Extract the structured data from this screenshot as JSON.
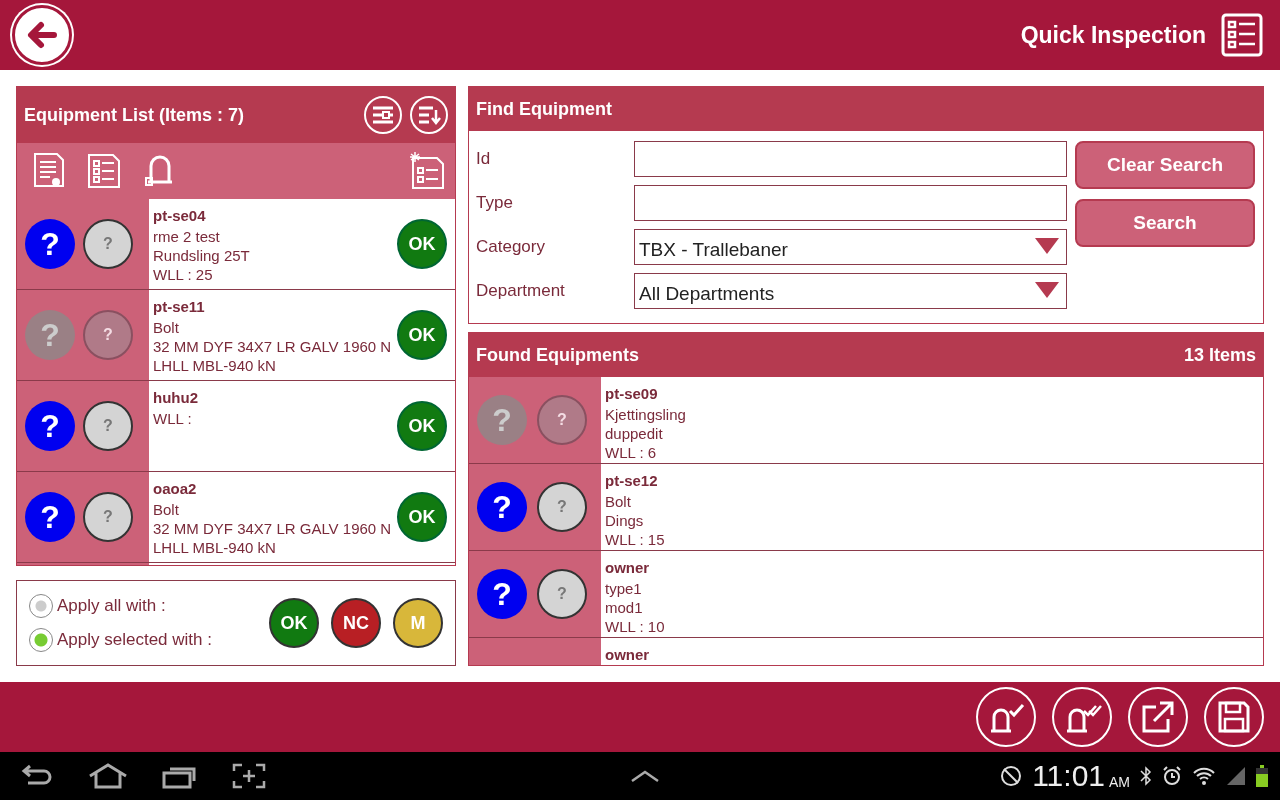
{
  "header": {
    "title": "Quick Inspection"
  },
  "equipment_list": {
    "title": "Equipment List (Items : 7)",
    "rows": [
      {
        "id": "pt-se04",
        "marks": [
          "?",
          "?"
        ],
        "lines": [
          "rme 2 test",
          "Rundsling 25T",
          "WLL : 25"
        ],
        "disabled": false,
        "status": "OK"
      },
      {
        "id": "pt-se11",
        "marks": [
          "?",
          "?"
        ],
        "lines": [
          "Bolt",
          "32 MM DYF 34X7 LR GALV 1960 N",
          "LHLL MBL-940 kN"
        ],
        "disabled": true,
        "status": "OK"
      },
      {
        "id": "huhu2",
        "marks": [
          "?",
          "?"
        ],
        "lines": [
          "WLL :"
        ],
        "disabled": false,
        "status": "OK"
      },
      {
        "id": "oaoa2",
        "marks": [
          "?",
          "?"
        ],
        "lines": [
          "Bolt",
          "32 MM DYF 34X7 LR GALV 1960 N",
          "LHLL MBL-940 kN"
        ],
        "disabled": false,
        "status": "OK"
      }
    ]
  },
  "apply": {
    "options": [
      {
        "label": "Apply all with :",
        "selected": false
      },
      {
        "label": "Apply selected with :",
        "selected": true
      }
    ],
    "buttons": [
      {
        "label": "OK",
        "color": "#117a11"
      },
      {
        "label": "NC",
        "color": "#b81f24"
      },
      {
        "label": "M",
        "color": "#d8b73a"
      }
    ]
  },
  "find": {
    "title": "Find Equipment",
    "fields": [
      {
        "label": "Id",
        "kind": "text"
      },
      {
        "label": "Type",
        "kind": "text"
      },
      {
        "label": "Category",
        "kind": "dropdown",
        "value": "TBX - Trallebaner"
      },
      {
        "label": "Department",
        "kind": "dropdown",
        "value": "All Departments"
      }
    ],
    "buttons": [
      "Clear Search",
      "Search"
    ]
  },
  "found": {
    "title": "Found Equipments",
    "count": "13 Items",
    "rows": [
      {
        "id": "pt-se09",
        "marks": [
          "?",
          "?"
        ],
        "lines": [
          "Kjettingsling",
          "duppedit",
          "WLL : 6"
        ],
        "disabled": true
      },
      {
        "id": "pt-se12",
        "marks": [
          "?",
          "?"
        ],
        "lines": [
          "Bolt",
          "Dings",
          "WLL : 15"
        ],
        "disabled": false
      },
      {
        "id": "owner",
        "marks": [
          "?",
          "?"
        ],
        "lines": [
          "type1",
          "mod1",
          "WLL : 10"
        ],
        "disabled": false
      },
      {
        "id": "owner",
        "lines": []
      }
    ]
  },
  "status_bar": {
    "time": "11:01",
    "ampm": "AM"
  }
}
